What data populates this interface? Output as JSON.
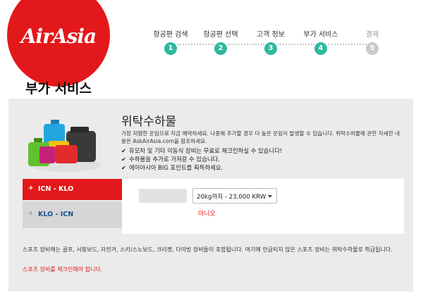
{
  "brand": {
    "logo_text": "AirAsia",
    "color": "#e3181b"
  },
  "steps": [
    {
      "label": "항공편 검색",
      "num": "1",
      "state": "done"
    },
    {
      "label": "항공편 선택",
      "num": "2",
      "state": "done"
    },
    {
      "label": "고객 정보",
      "num": "3",
      "state": "done"
    },
    {
      "label": "부가 서비스",
      "num": "4",
      "state": "current"
    },
    {
      "label": "결제",
      "num": "5",
      "state": "todo"
    }
  ],
  "page_title": "부가 서비스",
  "baggage": {
    "title": "위탁수하물",
    "description": "가장 저렴한 운임으로 지금 예약하세요. 나중에 추가할 경우 더 높은 운임이 발생할 수 있습니다. 위탁수하물에 관한 자세한 내용은 AskAirAsia.com을 참조하세요.",
    "checks": [
      "유모차 및 기타 이동식 장비는 무료로 체크인하실 수 있습니다!",
      "수하물을 추가로 가져갈 수 있습니다.",
      "에어아시아 BIG 포인트를 획득하세요."
    ],
    "check_icon": "✔"
  },
  "flights": [
    {
      "label": "ICN - KLO",
      "active": true,
      "icon": "✈"
    },
    {
      "label": "KLO - ICN",
      "active": false,
      "icon": "✈"
    }
  ],
  "selection": {
    "value": "20kg까지 - 23,000 KRW",
    "no_label": "아니오"
  },
  "sports_note": "스포츠 장비에는 골프, 서핑보드, 자전거, 스키/스노보드, 크리켓, 다이빙 장비들이 포함됩니다. 여기에 언급되지 않은 스포츠 장비는 위탁수하물로 취급됩니다.",
  "sports_warning": "스포츠 장비를 체크인해야 합니다."
}
